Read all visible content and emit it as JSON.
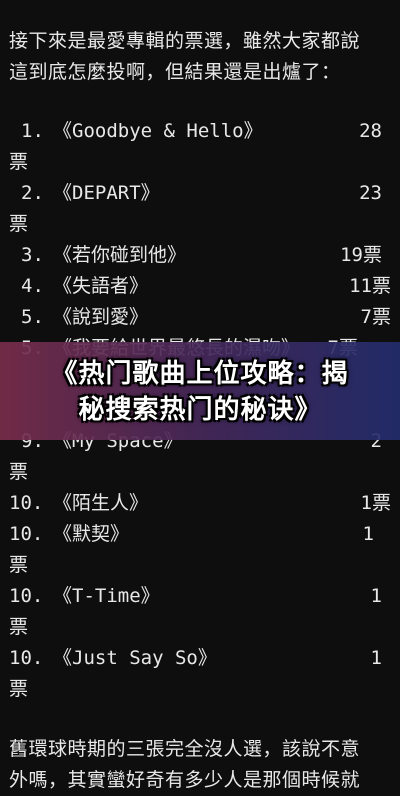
{
  "intro": {
    "line1": "接下來是最愛專輯的票選，雖然大家都說",
    "line2": "這到底怎麼投啊，但結果還是出爐了："
  },
  "rankings": [
    {
      "rank": "1.",
      "title": "《Goodbye & Hello》",
      "votes": "28",
      "unit": "票"
    },
    {
      "rank": "2.",
      "title": "《DEPART》",
      "votes": "23",
      "unit": "票"
    },
    {
      "rank": "3.",
      "title": "《若你碰到他》",
      "votes": "19票"
    },
    {
      "rank": "4.",
      "title": "《失語者》",
      "votes": "11票"
    },
    {
      "rank": "5.",
      "title": "《說到愛》",
      "votes": "7票"
    },
    {
      "rank": "5.",
      "title": "《我要給世界最悠長的濕吻》",
      "votes": "7票"
    },
    {
      "rank": "9.",
      "title": "《My Space》",
      "votes": "2",
      "unit": "票"
    },
    {
      "rank": "10.",
      "title": "《陌生人》",
      "votes": "1票"
    },
    {
      "rank": "10.",
      "title": "《默契》",
      "votes": "1",
      "unit": "票"
    },
    {
      "rank": "10.",
      "title": "《T-Time》",
      "votes": "1",
      "unit": "票"
    },
    {
      "rank": "10.",
      "title": "《Just Say So》",
      "votes": "1",
      "unit": "票"
    }
  ],
  "outro": {
    "line1": "舊環球時期的三張完全沒人選，該說不意",
    "line2": "外嗎，其實蠻好奇有多少人是那個時候就"
  },
  "banner": {
    "line1": "《热门歌曲上位攻略：揭",
    "line2": "秘搜索热门的秘诀》"
  }
}
